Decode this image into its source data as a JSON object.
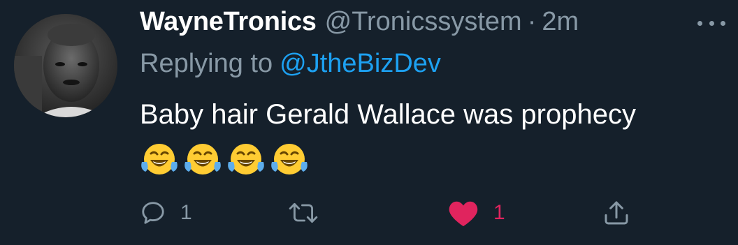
{
  "tweet": {
    "display_name": "WayneTronics",
    "handle": "@Tronicssystem",
    "separator": "·",
    "time": "2m",
    "replying_prefix": "Replying to",
    "replying_to": "@JtheBizDev",
    "text": "Baby hair Gerald Wallace was prophecy",
    "emojis": [
      "face-with-tears-of-joy",
      "face-with-tears-of-joy",
      "face-with-tears-of-joy",
      "face-with-tears-of-joy"
    ]
  },
  "actions": {
    "reply": {
      "icon": "reply-icon",
      "count": "1"
    },
    "retweet": {
      "icon": "retweet-icon",
      "count": ""
    },
    "like": {
      "icon": "heart-icon",
      "count": "1",
      "liked": true
    },
    "share": {
      "icon": "share-icon"
    }
  },
  "colors": {
    "background": "#15202b",
    "text": "#ffffff",
    "secondary": "#8899a6",
    "link": "#1da1f2",
    "like": "#e0245e"
  }
}
